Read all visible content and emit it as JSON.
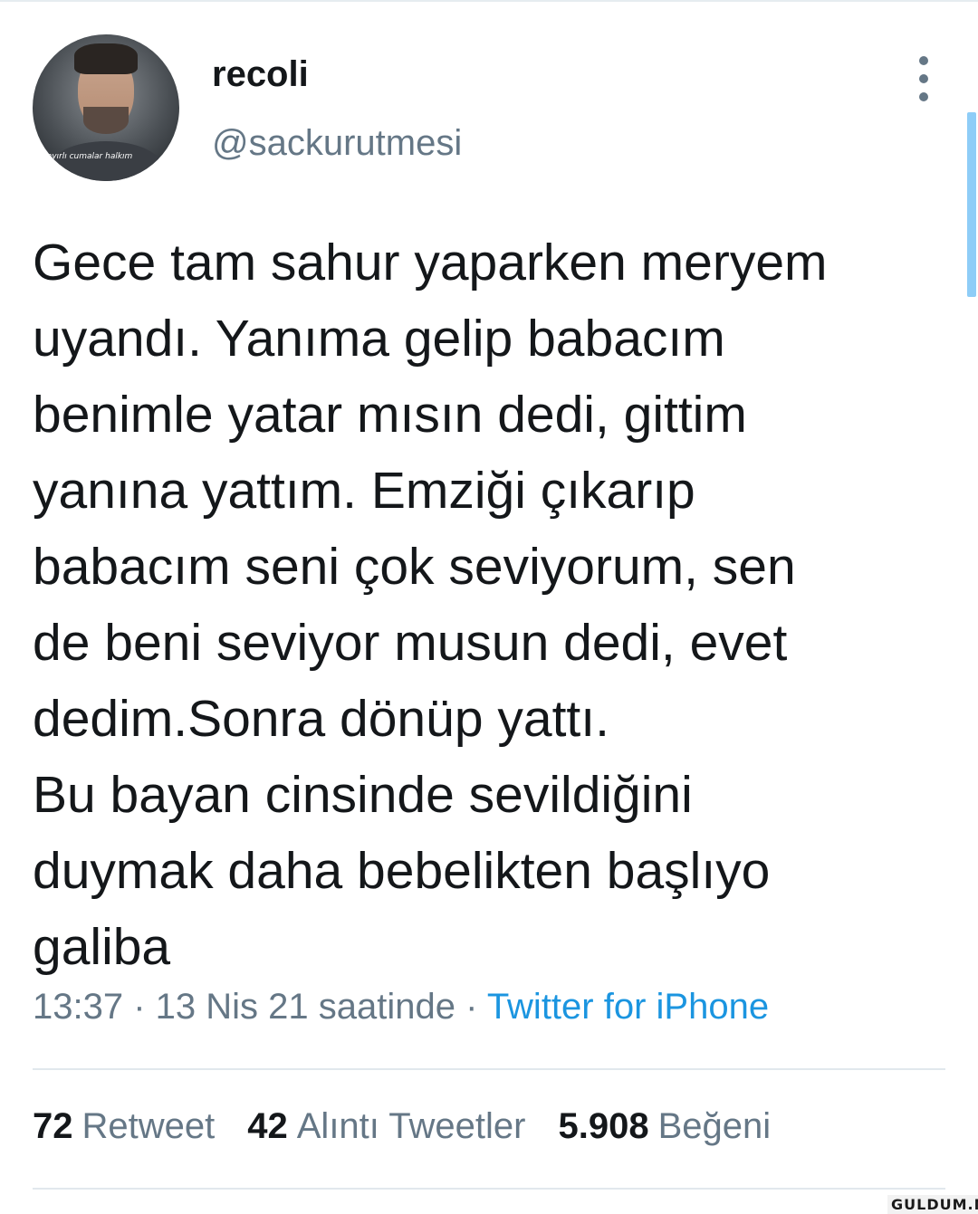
{
  "author": {
    "display_name": "recoli",
    "handle": "@sackurutmesi",
    "avatar_caption": "hayırlı cumalar halkım"
  },
  "tweet": {
    "lines": [
      "Gece tam sahur yaparken meryem",
      "uyandı. Yanıma gelip babacım",
      "benimle yatar mısın dedi, gittim",
      "yanına yattım. Emziği çıkarıp",
      "babacım seni çok seviyorum, sen",
      "de beni seviyor musun dedi, evet",
      "dedim.Sonra dönüp yattı.",
      "Bu bayan cinsinde sevildiğini",
      "duymak daha bebelikten başlıyo",
      "galiba"
    ]
  },
  "meta": {
    "time": "13:37",
    "separator1": " · ",
    "date": "13 Nis 21 saatinde",
    "separator2": " · ",
    "source": "Twitter for iPhone"
  },
  "stats": {
    "retweets": {
      "count": "72",
      "label": "Retweet"
    },
    "quotes": {
      "count": "42",
      "label": "Alıntı Tweetler"
    },
    "likes": {
      "count": "5.908",
      "label": "Beğeni"
    }
  },
  "icons": {
    "more": "more-vertical-icon"
  },
  "watermark": "GULDUM.NET",
  "colors": {
    "text": "#14171a",
    "secondary": "#657786",
    "link": "#1b95e0",
    "scrollbar": "#8ecdf7"
  }
}
